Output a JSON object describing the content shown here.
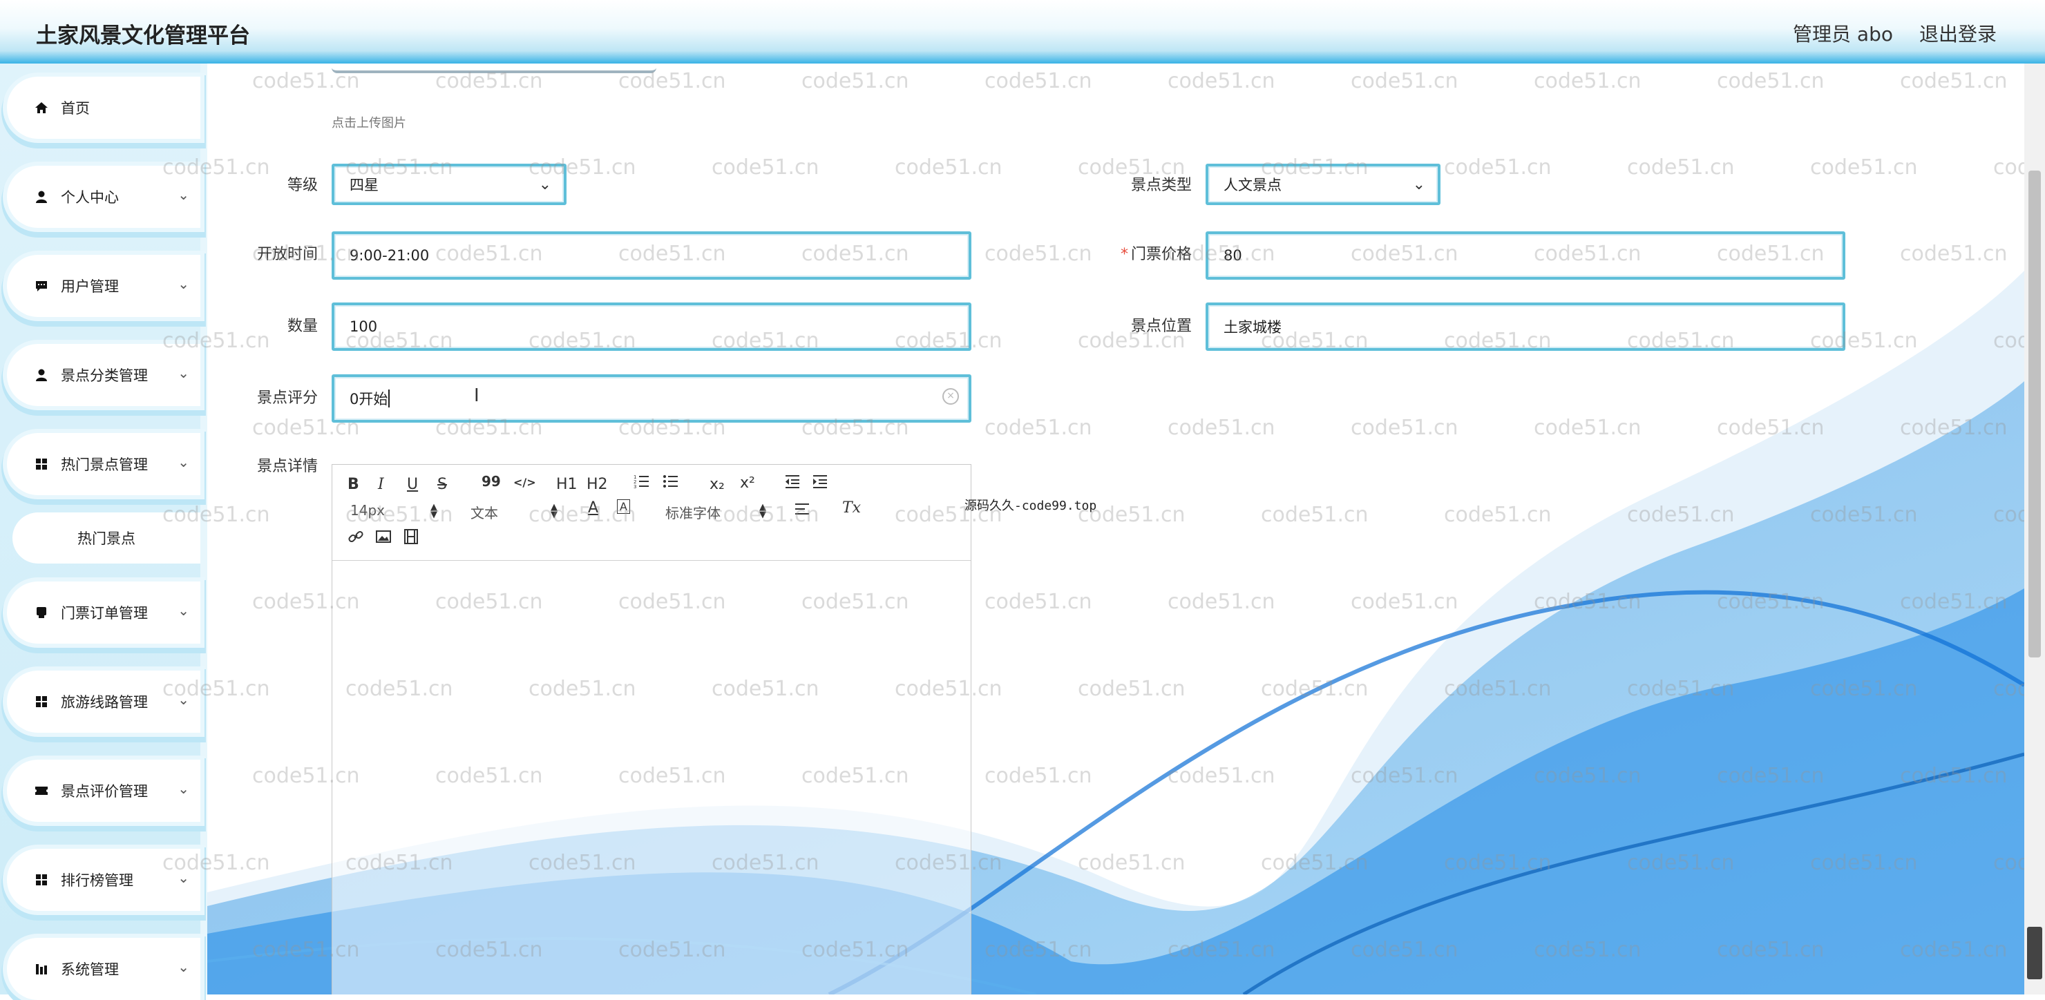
{
  "header": {
    "title": "土家风景文化管理平台",
    "admin": "管理员 abo",
    "logout": "退出登录"
  },
  "sidebar": {
    "items": [
      {
        "label": "首页",
        "icon": "home-icon"
      },
      {
        "label": "个人中心",
        "icon": "user-icon"
      },
      {
        "label": "用户管理",
        "icon": "chat-icon"
      },
      {
        "label": "景点分类管理",
        "icon": "user-icon"
      },
      {
        "label": "热门景点管理",
        "icon": "grid-icon"
      },
      {
        "label": "门票订单管理",
        "icon": "ticket-icon"
      },
      {
        "label": "旅游线路管理",
        "icon": "grid-icon"
      },
      {
        "label": "景点评价管理",
        "icon": "film-icon"
      },
      {
        "label": "排行榜管理",
        "icon": "grid-icon"
      },
      {
        "label": "系统管理",
        "icon": "chart-icon"
      }
    ],
    "submenu": {
      "label": "热门景点"
    }
  },
  "form": {
    "upload_hint": "点击上传图片",
    "grade": {
      "label": "等级",
      "value": "四星"
    },
    "type": {
      "label": "景点类型",
      "value": "人文景点"
    },
    "open_time": {
      "label": "开放时间",
      "value": "9:00-21:00"
    },
    "price": {
      "label": "门票价格",
      "value": "80",
      "required": "*"
    },
    "quantity": {
      "label": "数量",
      "value": "100"
    },
    "location": {
      "label": "景点位置",
      "value": "土家城楼"
    },
    "rating": {
      "label": "景点评分",
      "value": "0开始"
    },
    "detail": {
      "label": "景点详情"
    }
  },
  "editor": {
    "toolbar": {
      "bold": "B",
      "italic": "I",
      "underline": "U",
      "strike": "S",
      "quote": "99",
      "code": "</>",
      "h1": "H1",
      "h2": "H2",
      "sub": "x₂",
      "sup": "x²",
      "size": "14px",
      "format": "文本",
      "font": "标准字体",
      "clear": "Tx"
    }
  },
  "note": "源码久久-code99.top",
  "watermark": "code51.cn",
  "colors": {
    "accent": "#39b3e6",
    "field_border": "#5fbfd9",
    "wave": "#1e88e5"
  }
}
